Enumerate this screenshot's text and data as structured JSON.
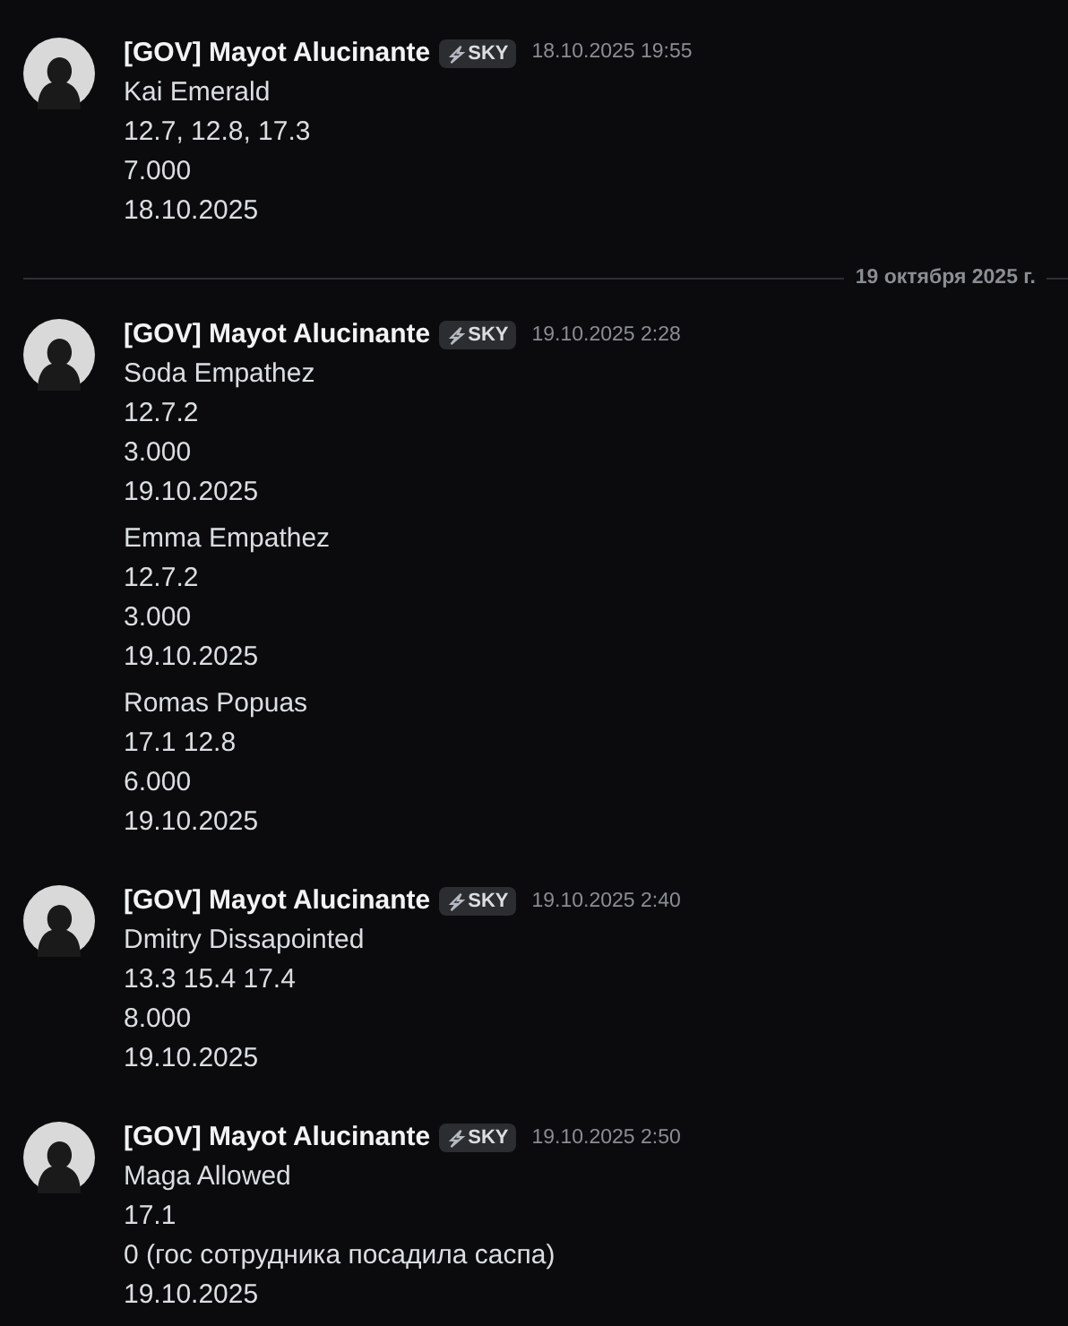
{
  "feed": [
    {
      "kind": "message",
      "author": "[GOV] Mayot Alucinante",
      "tag": "SKY",
      "time": "18.10.2025 19:55",
      "blocks": [
        [
          "Kai Emerald",
          "12.7, 12.8, 17.3",
          "7.000",
          "18.10.2025"
        ]
      ]
    },
    {
      "kind": "divider",
      "label": "19 октября 2025 г."
    },
    {
      "kind": "message",
      "author": "[GOV] Mayot Alucinante",
      "tag": "SKY",
      "time": "19.10.2025 2:28",
      "blocks": [
        [
          "Soda Empathez",
          "12.7.2",
          "3.000",
          "19.10.2025"
        ],
        [
          "Emma Empathez",
          "12.7.2",
          "3.000",
          "19.10.2025"
        ],
        [
          "Romas Popuas",
          "17.1 12.8",
          "6.000",
          "19.10.2025"
        ]
      ]
    },
    {
      "kind": "message",
      "author": "[GOV] Mayot Alucinante",
      "tag": "SKY",
      "time": "19.10.2025 2:40",
      "blocks": [
        [
          "Dmitry Dissapointed",
          "13.3 15.4 17.4",
          "8.000",
          "19.10.2025"
        ]
      ]
    },
    {
      "kind": "message",
      "author": "[GOV] Mayot Alucinante",
      "tag": "SKY",
      "time": "19.10.2025 2:50",
      "blocks": [
        [
          "Maga Allowed",
          "17.1",
          "0 (гос сотрудника посадила саспа)",
          "19.10.2025"
        ]
      ]
    }
  ]
}
